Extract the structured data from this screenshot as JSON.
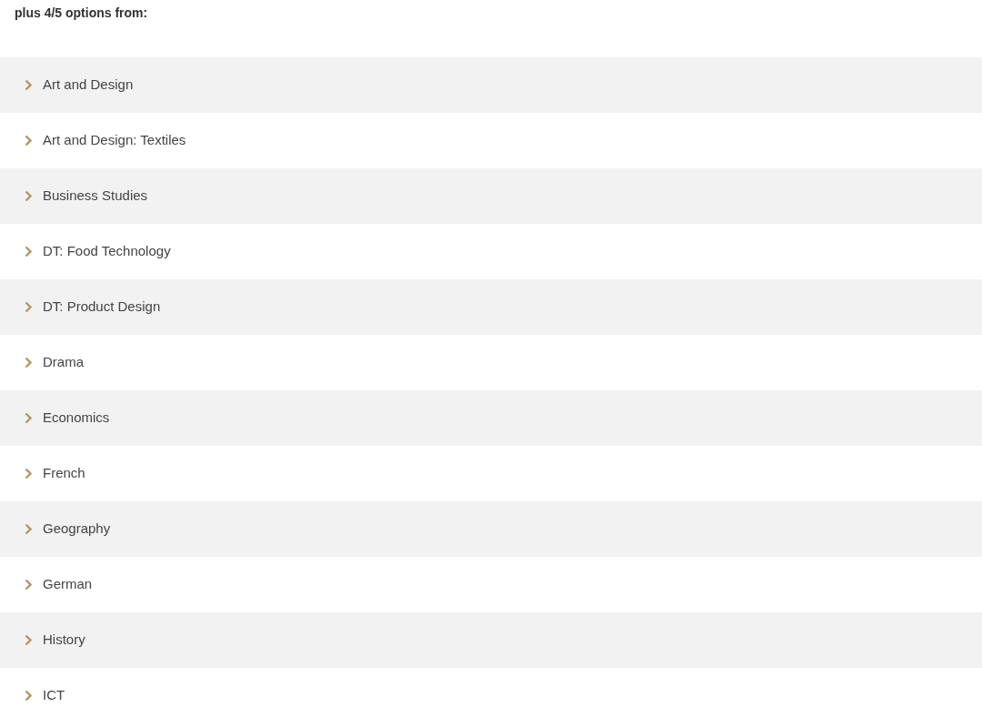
{
  "heading": "plus 4/5 options from:",
  "options": [
    {
      "label": "Art and Design",
      "expanded": false
    },
    {
      "label": "Art and Design: Textiles",
      "expanded": false
    },
    {
      "label": "Business Studies",
      "expanded": false
    },
    {
      "label": "DT: Food Technology",
      "expanded": false
    },
    {
      "label": "DT: Product Design",
      "expanded": false
    },
    {
      "label": "Drama",
      "expanded": false
    },
    {
      "label": "Economics",
      "expanded": false
    },
    {
      "label": "French",
      "expanded": false
    },
    {
      "label": "Geography",
      "expanded": false
    },
    {
      "label": "German",
      "expanded": false
    },
    {
      "label": "History",
      "expanded": false
    },
    {
      "label": "ICT",
      "expanded": false
    }
  ]
}
